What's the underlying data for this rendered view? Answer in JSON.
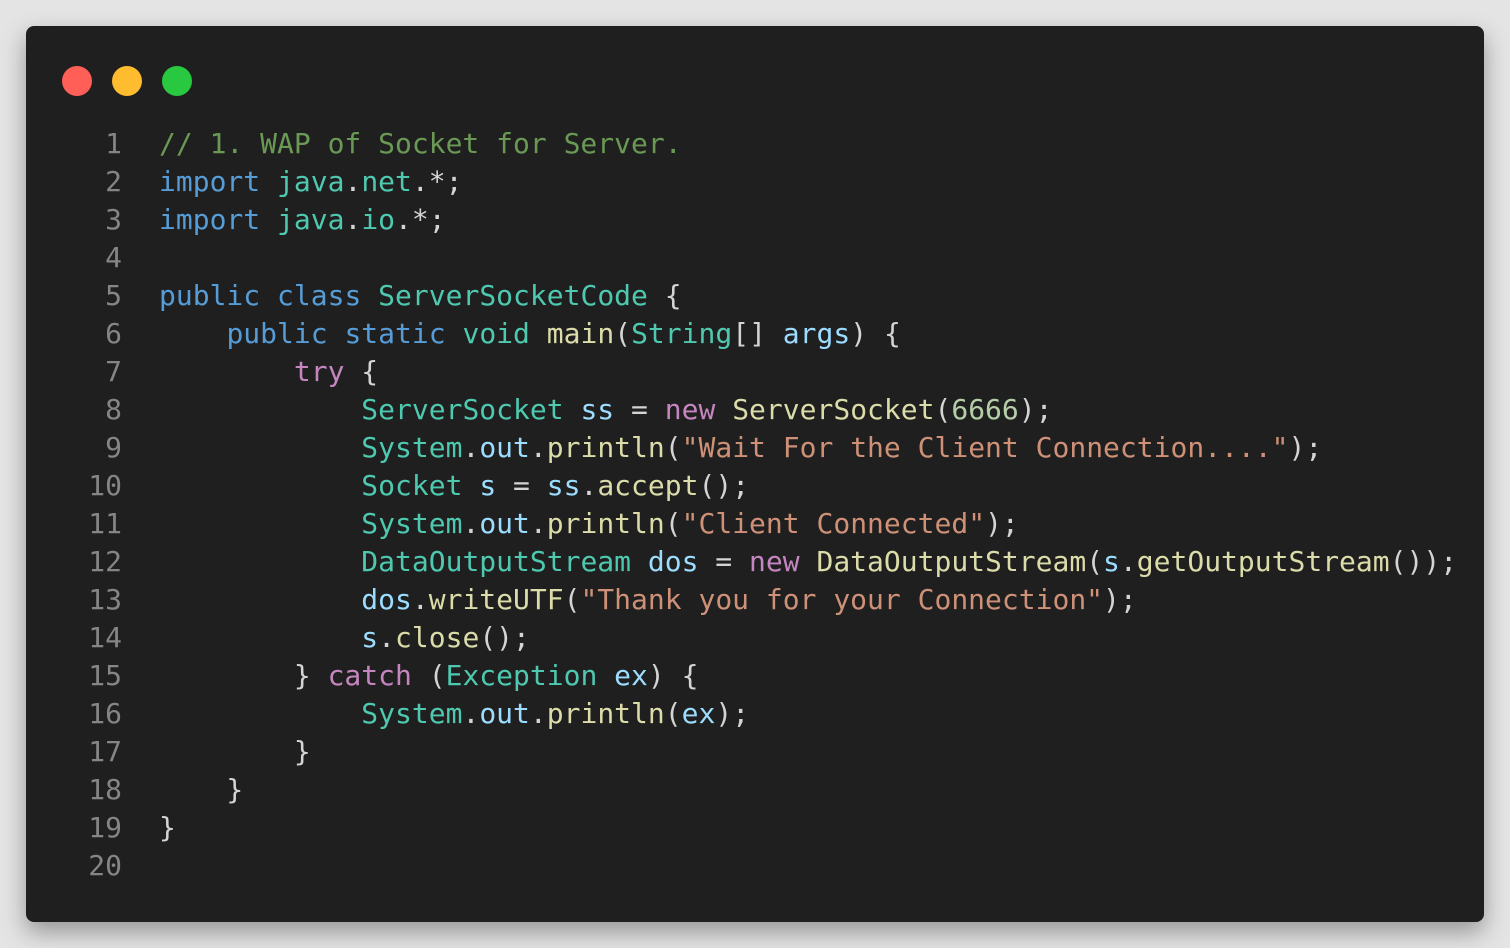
{
  "window": {
    "buttons": [
      {
        "name": "close",
        "color": "#ff5f57"
      },
      {
        "name": "minimize",
        "color": "#febc2e"
      },
      {
        "name": "maximize",
        "color": "#28c840"
      }
    ]
  },
  "code": {
    "lines": [
      {
        "n": "1",
        "tokens": [
          {
            "t": "// 1. WAP of Socket for Server.",
            "c": "comment"
          }
        ]
      },
      {
        "n": "2",
        "tokens": [
          {
            "t": "import",
            "c": "keyword"
          },
          {
            "t": " ",
            "c": "plain"
          },
          {
            "t": "java",
            "c": "type"
          },
          {
            "t": ".",
            "c": "plain"
          },
          {
            "t": "net",
            "c": "type"
          },
          {
            "t": ".*;",
            "c": "plain"
          }
        ]
      },
      {
        "n": "3",
        "tokens": [
          {
            "t": "import",
            "c": "keyword"
          },
          {
            "t": " ",
            "c": "plain"
          },
          {
            "t": "java",
            "c": "type"
          },
          {
            "t": ".",
            "c": "plain"
          },
          {
            "t": "io",
            "c": "type"
          },
          {
            "t": ".*;",
            "c": "plain"
          }
        ]
      },
      {
        "n": "4",
        "tokens": []
      },
      {
        "n": "5",
        "tokens": [
          {
            "t": "public",
            "c": "keyword"
          },
          {
            "t": " ",
            "c": "plain"
          },
          {
            "t": "class",
            "c": "keyword"
          },
          {
            "t": " ",
            "c": "plain"
          },
          {
            "t": "ServerSocketCode",
            "c": "type"
          },
          {
            "t": " {",
            "c": "plain"
          }
        ]
      },
      {
        "n": "6",
        "tokens": [
          {
            "t": "    ",
            "c": "plain"
          },
          {
            "t": "public",
            "c": "keyword"
          },
          {
            "t": " ",
            "c": "plain"
          },
          {
            "t": "static",
            "c": "keyword"
          },
          {
            "t": " ",
            "c": "plain"
          },
          {
            "t": "void",
            "c": "type"
          },
          {
            "t": " ",
            "c": "plain"
          },
          {
            "t": "main",
            "c": "func"
          },
          {
            "t": "(",
            "c": "plain"
          },
          {
            "t": "String",
            "c": "type"
          },
          {
            "t": "[] ",
            "c": "plain"
          },
          {
            "t": "args",
            "c": "var"
          },
          {
            "t": ") {",
            "c": "plain"
          }
        ]
      },
      {
        "n": "7",
        "tokens": [
          {
            "t": "        ",
            "c": "plain"
          },
          {
            "t": "try",
            "c": "control"
          },
          {
            "t": " {",
            "c": "plain"
          }
        ]
      },
      {
        "n": "8",
        "tokens": [
          {
            "t": "            ",
            "c": "plain"
          },
          {
            "t": "ServerSocket",
            "c": "type"
          },
          {
            "t": " ",
            "c": "plain"
          },
          {
            "t": "ss",
            "c": "var"
          },
          {
            "t": " = ",
            "c": "plain"
          },
          {
            "t": "new",
            "c": "control"
          },
          {
            "t": " ",
            "c": "plain"
          },
          {
            "t": "ServerSocket",
            "c": "func"
          },
          {
            "t": "(",
            "c": "plain"
          },
          {
            "t": "6666",
            "c": "number"
          },
          {
            "t": ");",
            "c": "plain"
          }
        ]
      },
      {
        "n": "9",
        "tokens": [
          {
            "t": "            ",
            "c": "plain"
          },
          {
            "t": "System",
            "c": "type"
          },
          {
            "t": ".",
            "c": "plain"
          },
          {
            "t": "out",
            "c": "var"
          },
          {
            "t": ".",
            "c": "plain"
          },
          {
            "t": "println",
            "c": "func"
          },
          {
            "t": "(",
            "c": "plain"
          },
          {
            "t": "\"Wait For the Client Connection....\"",
            "c": "string"
          },
          {
            "t": ");",
            "c": "plain"
          }
        ]
      },
      {
        "n": "10",
        "tokens": [
          {
            "t": "            ",
            "c": "plain"
          },
          {
            "t": "Socket",
            "c": "type"
          },
          {
            "t": " ",
            "c": "plain"
          },
          {
            "t": "s",
            "c": "var"
          },
          {
            "t": " = ",
            "c": "plain"
          },
          {
            "t": "ss",
            "c": "var"
          },
          {
            "t": ".",
            "c": "plain"
          },
          {
            "t": "accept",
            "c": "func"
          },
          {
            "t": "();",
            "c": "plain"
          }
        ]
      },
      {
        "n": "11",
        "tokens": [
          {
            "t": "            ",
            "c": "plain"
          },
          {
            "t": "System",
            "c": "type"
          },
          {
            "t": ".",
            "c": "plain"
          },
          {
            "t": "out",
            "c": "var"
          },
          {
            "t": ".",
            "c": "plain"
          },
          {
            "t": "println",
            "c": "func"
          },
          {
            "t": "(",
            "c": "plain"
          },
          {
            "t": "\"Client Connected\"",
            "c": "string"
          },
          {
            "t": ");",
            "c": "plain"
          }
        ]
      },
      {
        "n": "12",
        "tokens": [
          {
            "t": "            ",
            "c": "plain"
          },
          {
            "t": "DataOutputStream",
            "c": "type"
          },
          {
            "t": " ",
            "c": "plain"
          },
          {
            "t": "dos",
            "c": "var"
          },
          {
            "t": " = ",
            "c": "plain"
          },
          {
            "t": "new",
            "c": "control"
          },
          {
            "t": " ",
            "c": "plain"
          },
          {
            "t": "DataOutputStream",
            "c": "func"
          },
          {
            "t": "(",
            "c": "plain"
          },
          {
            "t": "s",
            "c": "var"
          },
          {
            "t": ".",
            "c": "plain"
          },
          {
            "t": "getOutputStream",
            "c": "func"
          },
          {
            "t": "());",
            "c": "plain"
          }
        ]
      },
      {
        "n": "13",
        "tokens": [
          {
            "t": "            ",
            "c": "plain"
          },
          {
            "t": "dos",
            "c": "var"
          },
          {
            "t": ".",
            "c": "plain"
          },
          {
            "t": "writeUTF",
            "c": "func"
          },
          {
            "t": "(",
            "c": "plain"
          },
          {
            "t": "\"Thank you for your Connection\"",
            "c": "string"
          },
          {
            "t": ");",
            "c": "plain"
          }
        ]
      },
      {
        "n": "14",
        "tokens": [
          {
            "t": "            ",
            "c": "plain"
          },
          {
            "t": "s",
            "c": "var"
          },
          {
            "t": ".",
            "c": "plain"
          },
          {
            "t": "close",
            "c": "func"
          },
          {
            "t": "();",
            "c": "plain"
          }
        ]
      },
      {
        "n": "15",
        "tokens": [
          {
            "t": "        } ",
            "c": "plain"
          },
          {
            "t": "catch",
            "c": "control"
          },
          {
            "t": " (",
            "c": "plain"
          },
          {
            "t": "Exception",
            "c": "type"
          },
          {
            "t": " ",
            "c": "plain"
          },
          {
            "t": "ex",
            "c": "var"
          },
          {
            "t": ") {",
            "c": "plain"
          }
        ]
      },
      {
        "n": "16",
        "tokens": [
          {
            "t": "            ",
            "c": "plain"
          },
          {
            "t": "System",
            "c": "type"
          },
          {
            "t": ".",
            "c": "plain"
          },
          {
            "t": "out",
            "c": "var"
          },
          {
            "t": ".",
            "c": "plain"
          },
          {
            "t": "println",
            "c": "func"
          },
          {
            "t": "(",
            "c": "plain"
          },
          {
            "t": "ex",
            "c": "var"
          },
          {
            "t": ");",
            "c": "plain"
          }
        ]
      },
      {
        "n": "17",
        "tokens": [
          {
            "t": "        }",
            "c": "plain"
          }
        ]
      },
      {
        "n": "18",
        "tokens": [
          {
            "t": "    }",
            "c": "plain"
          }
        ]
      },
      {
        "n": "19",
        "tokens": [
          {
            "t": "}",
            "c": "plain"
          }
        ]
      },
      {
        "n": "20",
        "tokens": []
      }
    ]
  }
}
